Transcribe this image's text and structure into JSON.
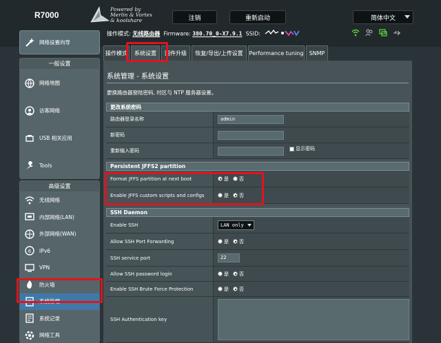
{
  "header": {
    "model": "R7000",
    "logo_text": "Powered by\nMerlin & Vortex\n& koolshare",
    "logout_label": "注销",
    "reboot_label": "重新启动",
    "language": "简体中文"
  },
  "infobar": {
    "mode_label": "操作模式:",
    "mode_value": "无线路由器",
    "firmware_label": "Firmware:",
    "firmware_value": "380.70_0-X7.9.1",
    "ssid_label": "SSID:"
  },
  "sidebar": {
    "qis_label": "网络设置向导",
    "general_title": "一般设置",
    "general_items": [
      {
        "label": "网络地图",
        "icon": "network-map-icon"
      },
      {
        "label": "访客网络",
        "icon": "guest-network-icon"
      },
      {
        "label": "USB 相关应用",
        "icon": "usb-icon"
      },
      {
        "label": "Tools",
        "icon": "wrench-icon"
      }
    ],
    "advanced_title": "高级设置",
    "advanced_items": [
      {
        "label": "无线网络",
        "icon": "wireless-icon"
      },
      {
        "label": "内部网络(LAN)",
        "icon": "lan-icon"
      },
      {
        "label": "外部网络(WAN)",
        "icon": "wan-icon"
      },
      {
        "label": "IPv6",
        "icon": "ipv6-icon"
      },
      {
        "label": "VPN",
        "icon": "vpn-icon"
      },
      {
        "label": "防火墙",
        "icon": "firewall-icon"
      },
      {
        "label": "系统管理",
        "icon": "admin-icon"
      },
      {
        "label": "系统记录",
        "icon": "log-icon"
      },
      {
        "label": "网络工具",
        "icon": "network-tools-icon"
      }
    ]
  },
  "tabs": [
    {
      "label": "操作模式"
    },
    {
      "label": "系统设置"
    },
    {
      "label": "固件升级"
    },
    {
      "label": "恢复/导出/上传设置"
    },
    {
      "label": "Performance tuning"
    },
    {
      "label": "SNMP"
    }
  ],
  "page": {
    "title": "系统管理 - 系统设置",
    "description": "更换路由器登陆密码, 时区与 NTP 服务器设置。"
  },
  "sections": {
    "password": {
      "header": "更改系统密码",
      "login_label": "路由器登录名称",
      "login_value": "admin",
      "new_pw_label": "新密码",
      "confirm_pw_label": "重新输入密码",
      "show_pw_label": "显示密码"
    },
    "jffs": {
      "header": "Persistent JFFS2 partition",
      "format_label": "Format JFFS partition at next boot",
      "enable_scripts_label": "Enable JFFS custom scripts and configs",
      "yes": "是",
      "no": "否"
    },
    "ssh": {
      "header": "SSH Daemon",
      "enable_label": "Enable SSH",
      "enable_value": "LAN only",
      "port_forward_label": "Allow SSH Port Forwarding",
      "port_label": "SSH service port",
      "port_value": "22",
      "password_login_label": "Allow SSH password login",
      "brute_label": "Enable SSH Brute Force Protection",
      "authkey_label": "SSH Authentication key"
    }
  },
  "colors": {
    "highlight": "#e0141e",
    "active_item": "#3f79a8"
  }
}
